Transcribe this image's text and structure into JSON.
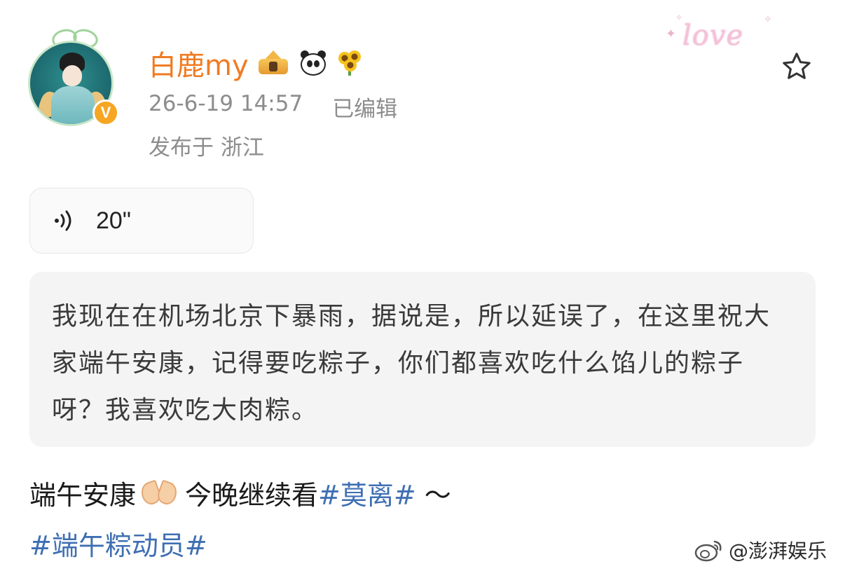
{
  "header": {
    "username": "白鹿my",
    "timestamp": "26-6-19 14:57",
    "edited_label": "已编辑",
    "location": "发布于 浙江",
    "verified_badge": "V"
  },
  "sticker": {
    "text": "love"
  },
  "voice": {
    "duration": "20\""
  },
  "transcript": {
    "text": "我现在在机场北京下暴雨，据说是，所以延误了，在这里祝大家端午安康，记得要吃粽子，你们都喜欢吃什么馅儿的粽子呀？我喜欢吃大肉粽。"
  },
  "post": {
    "line1_prefix": "端午安康",
    "line1_middle": "今晚继续看",
    "hashtag1": "#莫离#",
    "line1_suffix": " ～",
    "hashtag2": "#端午粽动员#"
  },
  "watermark": {
    "text": "@澎湃娱乐"
  },
  "colors": {
    "username": "#f07b22",
    "hashtag": "#3f6fb3",
    "meta": "#8d8d8d",
    "transcript_bg": "#f4f4f4"
  }
}
